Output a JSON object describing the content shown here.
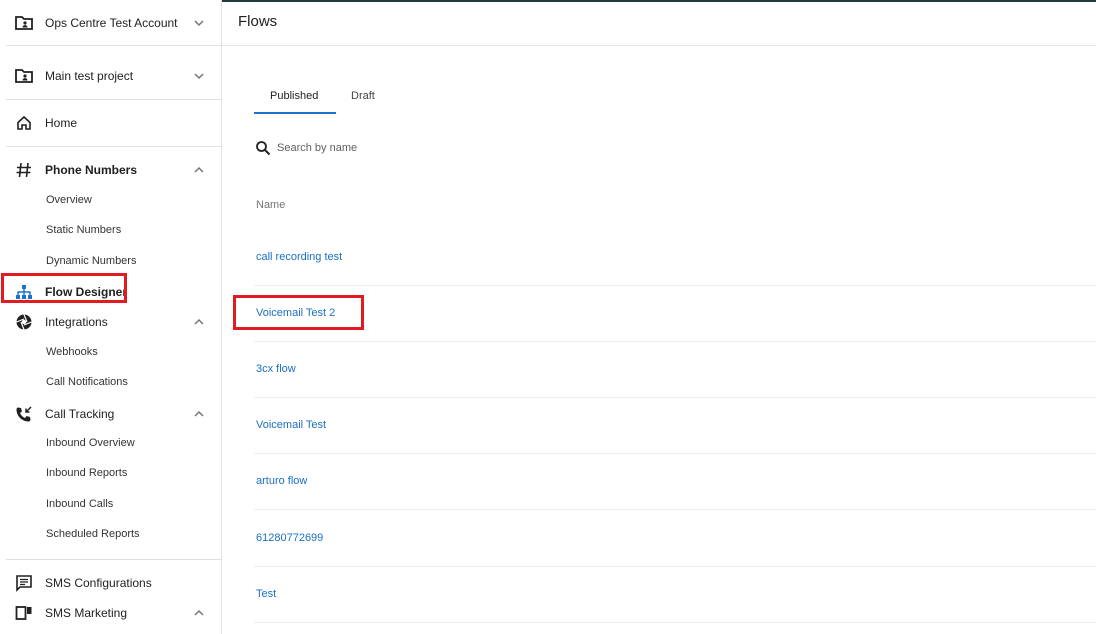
{
  "sidebar": {
    "account": {
      "label": "Ops Centre Test Account",
      "icon": "folder-account-icon"
    },
    "project": {
      "label": "Main test project",
      "icon": "folder-account-icon"
    },
    "home": {
      "label": "Home",
      "icon": "home-icon"
    },
    "phone_numbers": {
      "label": "Phone Numbers",
      "icon": "hashtag-icon",
      "items": [
        "Overview",
        "Static Numbers",
        "Dynamic Numbers"
      ]
    },
    "flow_designer": {
      "label": "Flow Designer",
      "icon": "sitemap-icon"
    },
    "integrations": {
      "label": "Integrations",
      "icon": "aperture-icon",
      "items": [
        "Webhooks",
        "Call Notifications"
      ]
    },
    "call_tracking": {
      "label": "Call Tracking",
      "icon": "phone-incoming-icon",
      "items": [
        "Inbound Overview",
        "Inbound Reports",
        "Inbound Calls",
        "Scheduled Reports"
      ]
    },
    "sms_configurations": {
      "label": "SMS Configurations",
      "icon": "message-icon"
    },
    "sms_marketing": {
      "label": "SMS Marketing",
      "icon": "devices-icon"
    }
  },
  "main": {
    "title": "Flows",
    "tabs": [
      "Published",
      "Draft"
    ],
    "active_tab": "Published",
    "search": {
      "placeholder": "Search by name"
    },
    "column_header": "Name",
    "flows": [
      "call recording test",
      "Voicemail Test 2",
      "3cx flow",
      "Voicemail Test",
      "arturo flow",
      "61280772699",
      "Test"
    ]
  },
  "colors": {
    "accent": "#1a73c8",
    "link": "#1a6fc4",
    "highlight_box": "#e01b22",
    "top_bar": "#1f3a3d"
  }
}
